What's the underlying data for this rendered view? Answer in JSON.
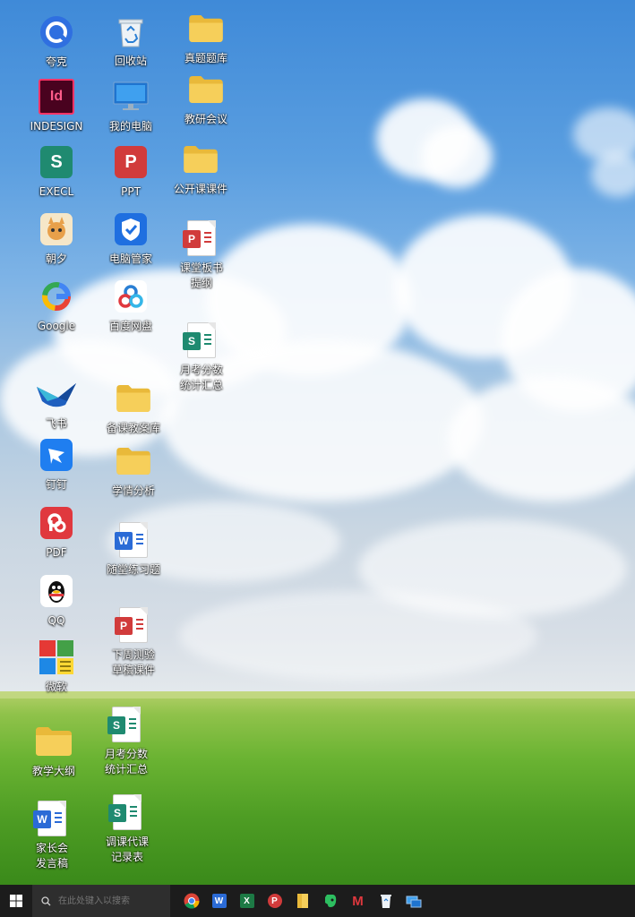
{
  "desktop_icons": {
    "kuake": "夸克",
    "recycle": "回收站",
    "zhenti": "真题题库",
    "indesign": "INDESIGN",
    "mycomputer": "我的电脑",
    "jiaoyan": "教研会议",
    "execl": "EXECL",
    "ppt": "PPT",
    "gongkai": "公开课课件",
    "zhaoxi": "朝夕",
    "diannao_guanjia": "电脑管家",
    "ketang_banshu": "课堂板书\n提纲",
    "google": "Google",
    "baidu_pan": "百度网盘",
    "yuekao_1": "月考分数\n统计汇总",
    "feishu": "飞书",
    "beike": "备课教案库",
    "dingding": "钉钉",
    "xueqing": "学情分析",
    "pdf": "PDF",
    "suitang": "随堂练习题",
    "qq": "QQ",
    "xiazhou": "下周测验\n草稿课件",
    "weiruan": "微软",
    "jiaoxue_dagang": "教学大纲",
    "yuekao_2": "月考分数\n统计汇总",
    "jiazhang": "家长会\n发言稿",
    "tiaoke": "调课代课\n记录表"
  },
  "taskbar": {
    "search_placeholder": "在此处键入以搜索",
    "app_letters": {
      "word": "W",
      "excel": "X",
      "wps": "P",
      "mail": "M"
    }
  },
  "colors": {
    "folder": "#f2c94c",
    "wps_red": "#d13b3b",
    "sheet_green": "#1f8a70",
    "word_blue": "#2b6bd6",
    "indesign": "#49021f",
    "taskbar": "#1c1c1c"
  }
}
